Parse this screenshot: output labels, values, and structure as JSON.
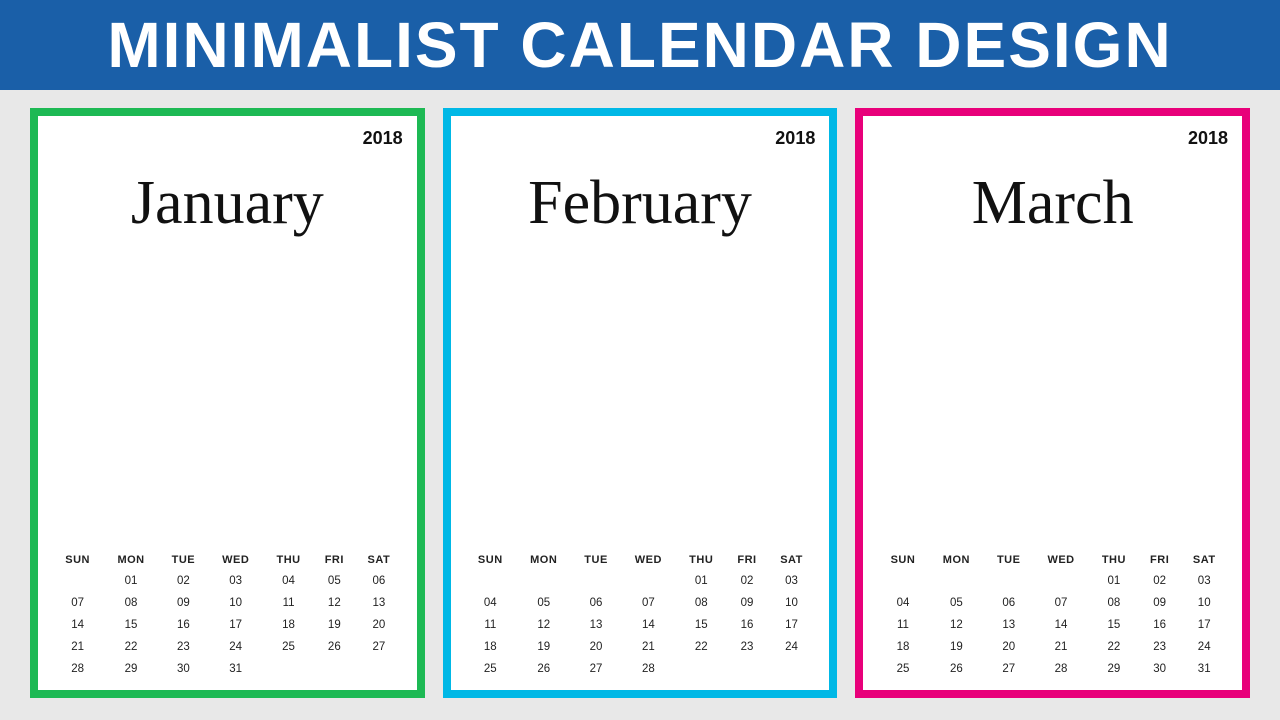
{
  "header": {
    "title": "MINIMALIST CALENDAR DESIGN",
    "bg_color": "#1a5fa8"
  },
  "calendars": [
    {
      "id": "january",
      "month": "January",
      "year": "2018",
      "color": "green",
      "border_color": "#1db954",
      "days": [
        "SUN",
        "MON",
        "TUE",
        "WED",
        "THU",
        "FRI",
        "SAT"
      ],
      "weeks": [
        [
          "",
          "01",
          "02",
          "03",
          "04",
          "05",
          "06"
        ],
        [
          "07",
          "08",
          "09",
          "10",
          "11",
          "12",
          "13"
        ],
        [
          "14",
          "15",
          "16",
          "17",
          "18",
          "19",
          "20"
        ],
        [
          "21",
          "22",
          "23",
          "24",
          "25",
          "26",
          "27"
        ],
        [
          "28",
          "29",
          "30",
          "31",
          "",
          "",
          ""
        ]
      ]
    },
    {
      "id": "february",
      "month": "February",
      "year": "2018",
      "color": "cyan",
      "border_color": "#00b8e6",
      "days": [
        "SUN",
        "MON",
        "TUE",
        "WED",
        "THU",
        "FRI",
        "SAT"
      ],
      "weeks": [
        [
          "",
          "",
          "",
          "",
          "01",
          "02",
          "03"
        ],
        [
          "04",
          "05",
          "06",
          "07",
          "08",
          "09",
          "10"
        ],
        [
          "11",
          "12",
          "13",
          "14",
          "15",
          "16",
          "17"
        ],
        [
          "18",
          "19",
          "20",
          "21",
          "22",
          "23",
          "24"
        ],
        [
          "25",
          "26",
          "27",
          "28",
          "",
          "",
          ""
        ]
      ]
    },
    {
      "id": "march",
      "month": "March",
      "year": "2018",
      "color": "pink",
      "border_color": "#e8007a",
      "days": [
        "SUN",
        "MON",
        "TUE",
        "WED",
        "THU",
        "FRI",
        "SAT"
      ],
      "weeks": [
        [
          "",
          "",
          "",
          "",
          "01",
          "02",
          "03"
        ],
        [
          "04",
          "05",
          "06",
          "07",
          "08",
          "09",
          "10"
        ],
        [
          "11",
          "12",
          "13",
          "14",
          "15",
          "16",
          "17"
        ],
        [
          "18",
          "19",
          "20",
          "21",
          "22",
          "23",
          "24"
        ],
        [
          "25",
          "26",
          "27",
          "28",
          "29",
          "30",
          "31"
        ]
      ]
    }
  ]
}
